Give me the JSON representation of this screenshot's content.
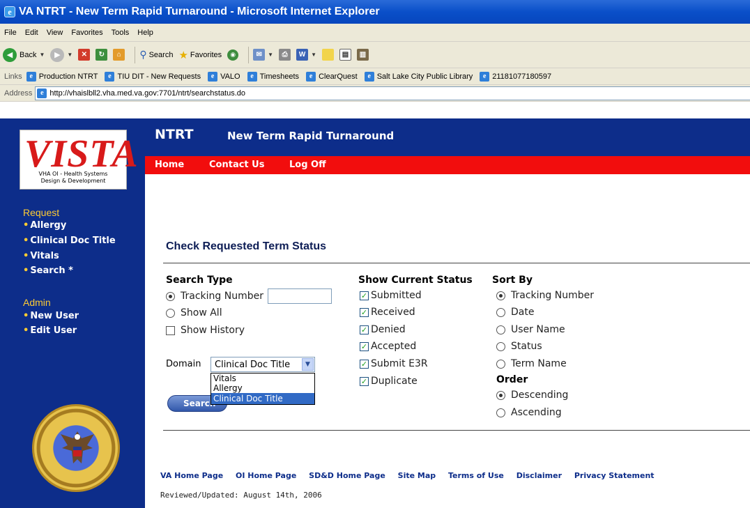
{
  "window": {
    "title": "VA NTRT - New Term Rapid Turnaround - Microsoft Internet Explorer"
  },
  "menu": [
    "File",
    "Edit",
    "View",
    "Favorites",
    "Tools",
    "Help"
  ],
  "toolbar": {
    "back": "Back",
    "search": "Search",
    "favorites": "Favorites"
  },
  "links": {
    "label": "Links",
    "items": [
      "Production NTRT",
      "TIU DIT - New Requests",
      "VALO",
      "Timesheets",
      "ClearQuest",
      "Salt Lake City Public Library",
      "21181077180597"
    ]
  },
  "address": {
    "label": "Address",
    "url": "http://vhaislbll2.vha.med.va.gov:7701/ntrt/searchstatus.do"
  },
  "logo": {
    "text": "VISTA",
    "caption_line1": "VHA OI - Health Systems",
    "caption_line2": "Design & Development"
  },
  "sidebar": {
    "request_heading": "Request",
    "request_items": [
      "Allergy",
      "Clinical Doc Title",
      "Vitals",
      "Search *"
    ],
    "admin_heading": "Admin",
    "admin_items": [
      "New User",
      "Edit User"
    ]
  },
  "header": {
    "app": "NTRT",
    "subtitle": "New Term Rapid Turnaround"
  },
  "nav": [
    "Home",
    "Contact Us",
    "Log Off"
  ],
  "page_title": "Check Requested Term Status",
  "search_type": {
    "heading": "Search Type",
    "tracking_number": "Tracking Number",
    "tracking_number_value": "",
    "show_all": "Show All",
    "show_history": "Show History",
    "selected": "tracking_number"
  },
  "status": {
    "heading": "Show Current Status",
    "items": [
      {
        "label": "Submitted",
        "checked": true
      },
      {
        "label": "Received",
        "checked": true
      },
      {
        "label": "Denied",
        "checked": true
      },
      {
        "label": "Accepted",
        "checked": true
      },
      {
        "label": "Submit E3R",
        "checked": true
      },
      {
        "label": "Duplicate",
        "checked": true
      }
    ]
  },
  "sort": {
    "heading": "Sort By",
    "items": [
      "Tracking Number",
      "Date",
      "User Name",
      "Status",
      "Term Name"
    ],
    "selected": "Tracking Number",
    "order_heading": "Order",
    "order_items": [
      "Descending",
      "Ascending"
    ],
    "order_selected": "Descending"
  },
  "domain": {
    "label": "Domain",
    "selected": "Clinical Doc Title",
    "options": [
      "Vitals",
      "Allergy",
      "Clinical Doc Title"
    ]
  },
  "search_button": "Search",
  "footer": {
    "links": [
      "VA Home Page",
      "OI Home Page",
      "SD&D Home Page",
      "Site Map",
      "Terms of Use",
      "Disclaimer",
      "Privacy Statement"
    ],
    "reviewed": "Reviewed/Updated: August 14th, 2006"
  },
  "colors": {
    "navy": "#0d2d8a",
    "red_nav": "#f20d0d",
    "sidebar_heading": "#ffcc33"
  }
}
